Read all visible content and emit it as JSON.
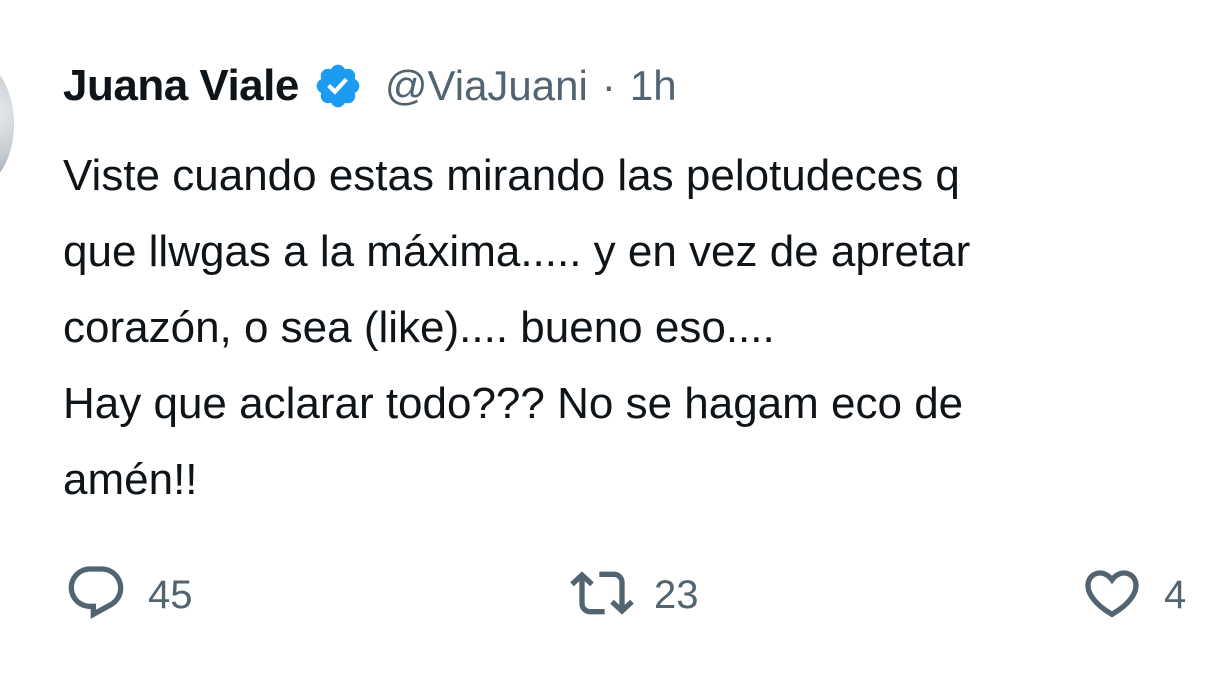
{
  "author": {
    "display_name": "Juana Viale",
    "handle": "@ViaJuani",
    "separator": "·",
    "time": "1h",
    "verified_color": "#1d9bf0"
  },
  "tweet": {
    "lines": [
      "Viste cuando estas mirando las pelotudeces q",
      "que llwgas a la máxima..... y en vez de apretar",
      "corazón, o sea (like).... bueno eso....",
      "Hay que aclarar todo??? No se hagam eco de",
      "amén!!"
    ]
  },
  "actions": {
    "reply_count": "45",
    "retweet_count": "23",
    "like_count": "4"
  },
  "icons": {
    "reply": "reply-icon",
    "retweet": "retweet-icon",
    "like": "heart-icon",
    "verified": "verified-badge-icon"
  }
}
